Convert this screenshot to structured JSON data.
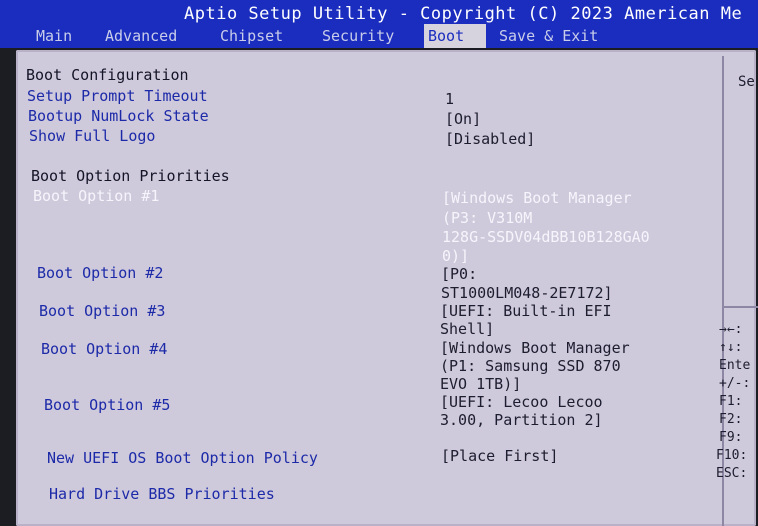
{
  "title": "Aptio Setup Utility - Copyright (C) 2023 American Me",
  "tabs": [
    "Main",
    "Advanced",
    "Chipset",
    "Security",
    "Boot",
    "Save & Exit"
  ],
  "active_tab": "Boot",
  "section_title": "Boot Configuration",
  "settings": [
    {
      "label": "Setup Prompt Timeout",
      "value": "1"
    },
    {
      "label": "Bootup NumLock State",
      "value": "[On]"
    },
    {
      "label": "Show Full Logo",
      "value": "[Disabled]"
    }
  ],
  "priorities_title": "Boot Option Priorities",
  "boot_options": [
    {
      "label": "Boot Option #1",
      "value_lines": [
        "[Windows Boot Manager",
        "(P3: V310M",
        "128G-SSDV04dBB10B128GA0",
        "0)]"
      ]
    },
    {
      "label": "Boot Option #2",
      "value_lines": [
        "[P0:",
        "ST1000LM048-2E7172]"
      ]
    },
    {
      "label": "Boot Option #3",
      "value_lines": [
        "[UEFI: Built-in EFI",
        "Shell]"
      ]
    },
    {
      "label": "Boot Option #4",
      "value_lines": [
        "[Windows Boot Manager",
        "(P1: Samsung SSD 870",
        "EVO 1TB)]"
      ]
    },
    {
      "label": "Boot Option #5",
      "value_lines": [
        "[UEFI: Lecoo Lecoo",
        "3.00, Partition 2]"
      ]
    }
  ],
  "policy": {
    "label": "New UEFI OS Boot Option Policy",
    "value": "[Place First]"
  },
  "bbs": {
    "label": "Hard Drive BBS Priorities"
  },
  "help_top": "Se",
  "help_keys": [
    "→←:",
    "↑↓:",
    "Ente",
    "+/-:",
    "F1:",
    "F2:",
    "F9:",
    "F10:",
    "ESC:"
  ]
}
